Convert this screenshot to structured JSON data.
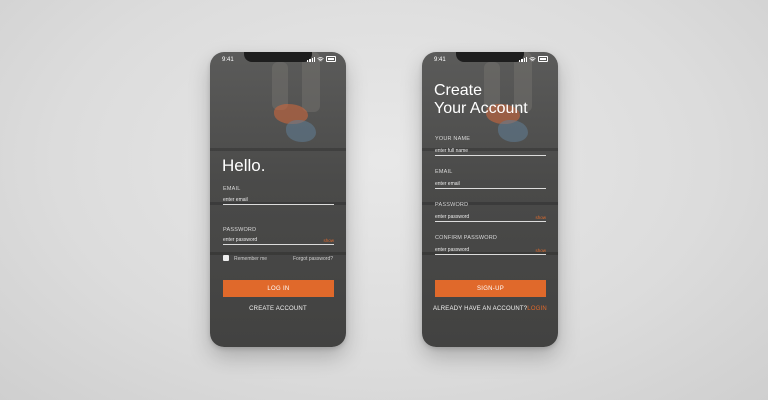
{
  "status": {
    "time": "9:41"
  },
  "login": {
    "title": "Hello.",
    "email_label": "EMAIL",
    "email_placeholder": "enter email",
    "password_label": "PASSWORD",
    "password_placeholder": "enter password",
    "show_label": "show",
    "remember_label": "Remember me",
    "forgot_label": "Forgot password?",
    "login_button": "LOG IN",
    "create_account_link": "CREATE ACCOUNT"
  },
  "signup": {
    "title_line1": "Create",
    "title_line2": "Your Account",
    "name_label": "YOUR NAME",
    "name_placeholder": "enter full name",
    "email_label": "EMAIL",
    "email_placeholder": "enter email",
    "password_label": "PASSWORD",
    "password_placeholder": "enter password",
    "confirm_label": "CONFIRM PASSWORD",
    "confirm_placeholder": "enter password",
    "show_label": "show",
    "signup_button": "SIGN-UP",
    "have_account_text": "ALREADY HAVE AN ACCOUNT?",
    "login_link": "LOGIN"
  },
  "colors": {
    "accent": "#e0692b",
    "screen": "#4a4a49",
    "background": "#dcdcdc"
  }
}
